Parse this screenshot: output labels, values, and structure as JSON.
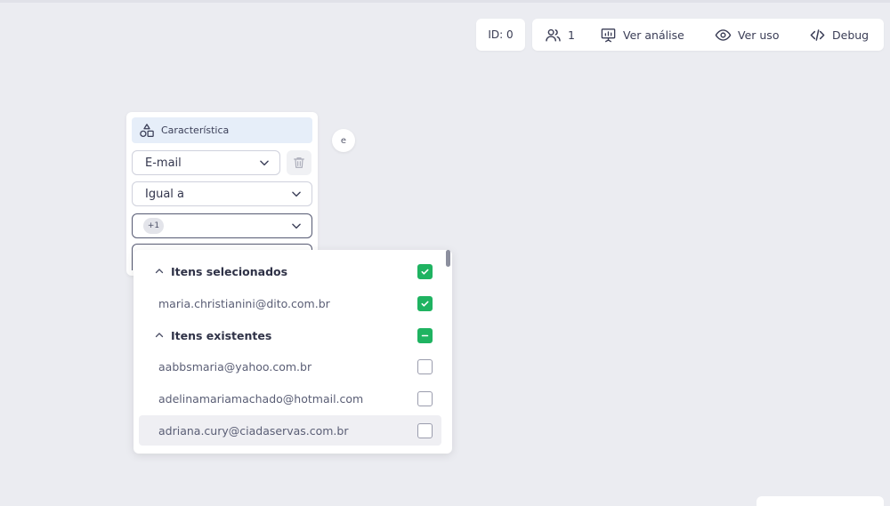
{
  "header": {
    "id_label": "ID: 0",
    "users_count": "1",
    "view_analysis": "Ver análise",
    "view_usage": "Ver uso",
    "debug": "Debug"
  },
  "card": {
    "header_label": "Característica",
    "field_select": "E-mail",
    "operator_select": "Igual a",
    "value_tag": "+1"
  },
  "connector": {
    "label": "e"
  },
  "dropdown": {
    "selected_group": "Itens selecionados",
    "selected_items": [
      "maria.christianini@dito.com.br"
    ],
    "existing_group": "Itens existentes",
    "existing_items": [
      "aabbsmaria@yahoo.com.br",
      "adelinamariamachado@hotmail.com",
      "adriana.cury@ciadaservas.com.br"
    ]
  },
  "colors": {
    "accent_green": "#1fb361",
    "background": "#ebecf1",
    "header_highlight": "#e6eef9"
  }
}
